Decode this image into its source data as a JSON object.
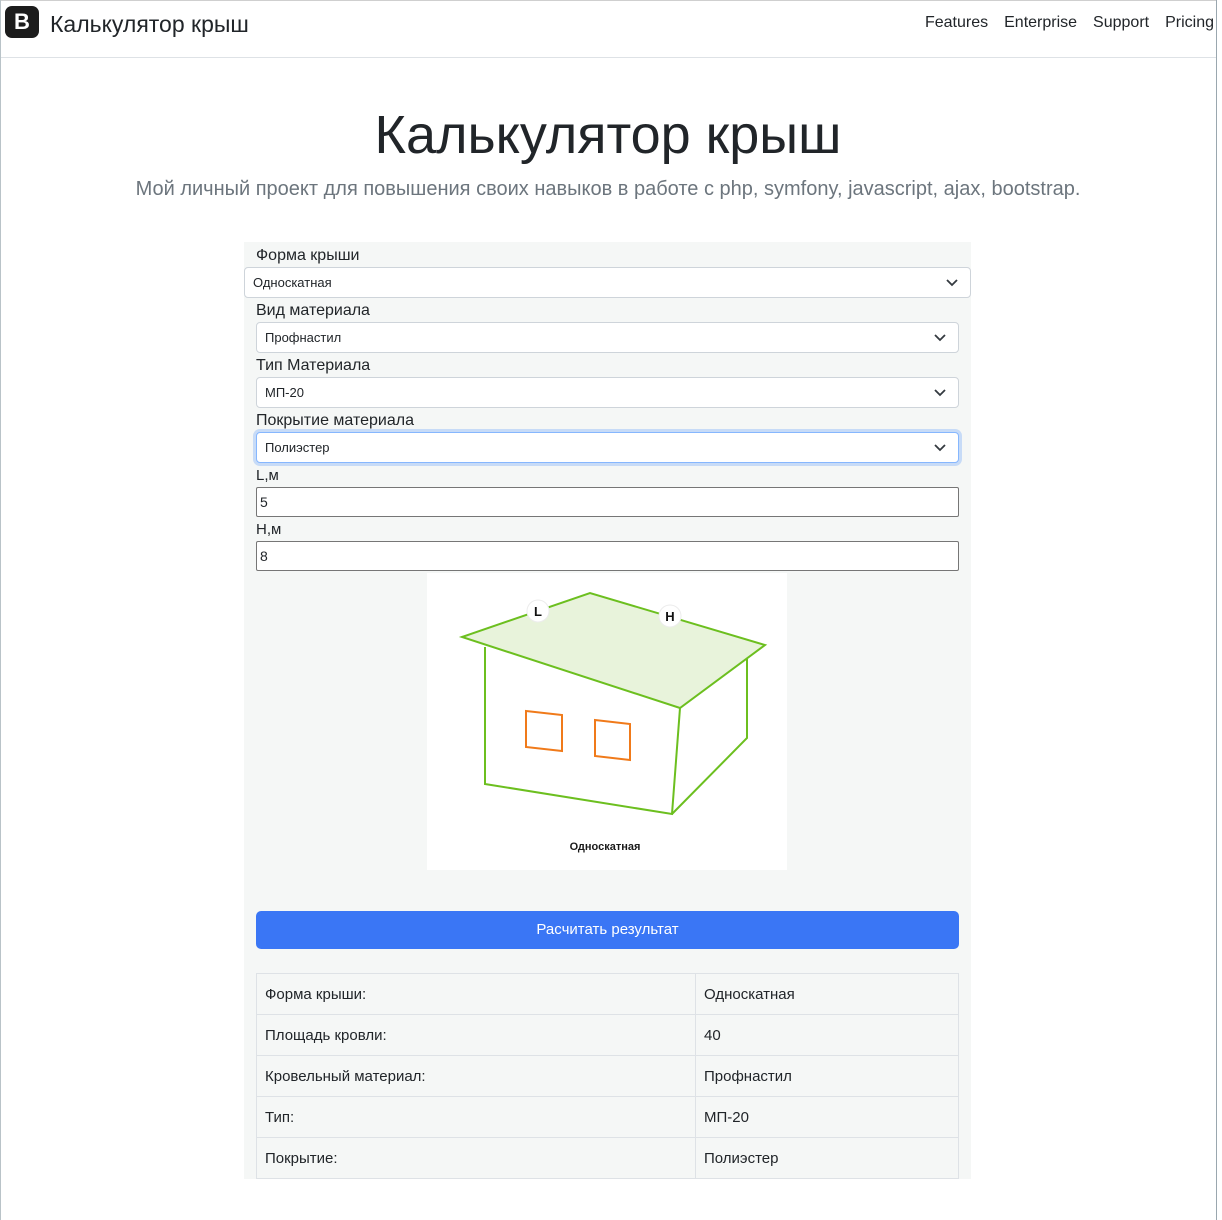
{
  "header": {
    "brand_logo_text": "B",
    "title": "Калькулятор крыш",
    "nav": [
      "Features",
      "Enterprise",
      "Support",
      "Pricing"
    ]
  },
  "hero": {
    "title": "Калькулятор крыш",
    "subtitle": "Мой личный проект для повышения своих навыков в работе с php, symfony, javascript, ajax, bootstrap."
  },
  "form": {
    "roof_shape": {
      "label": "Форма крыши",
      "value": "Односкатная"
    },
    "material_kind": {
      "label": "Вид материала",
      "value": "Профнастил"
    },
    "material_type": {
      "label": "Тип Материала",
      "value": "МП-20"
    },
    "material_coating": {
      "label": "Покрытие материала",
      "value": "Полиэстер"
    },
    "length": {
      "label": "L,м",
      "value": "5"
    },
    "height": {
      "label": "H,м",
      "value": "8"
    }
  },
  "illustration": {
    "label_l": "L",
    "label_h": "H",
    "caption": "Односкатная",
    "colors": {
      "outline": "#6cbf1f",
      "roof_fill": "#e8f3db",
      "window": "#f07a1a"
    }
  },
  "submit_label": "Расчитать результат",
  "results": [
    {
      "key": "Форма крыши:",
      "value": "Односкатная"
    },
    {
      "key": "Площадь кровли:",
      "value": "40"
    },
    {
      "key": "Кровельный материал:",
      "value": "Профнастил"
    },
    {
      "key": "Тип:",
      "value": "МП-20"
    },
    {
      "key": "Покрытие:",
      "value": "Полиэстер"
    }
  ],
  "colors": {
    "primary": "#3a76f5",
    "panel_bg": "#f5f7f6"
  }
}
